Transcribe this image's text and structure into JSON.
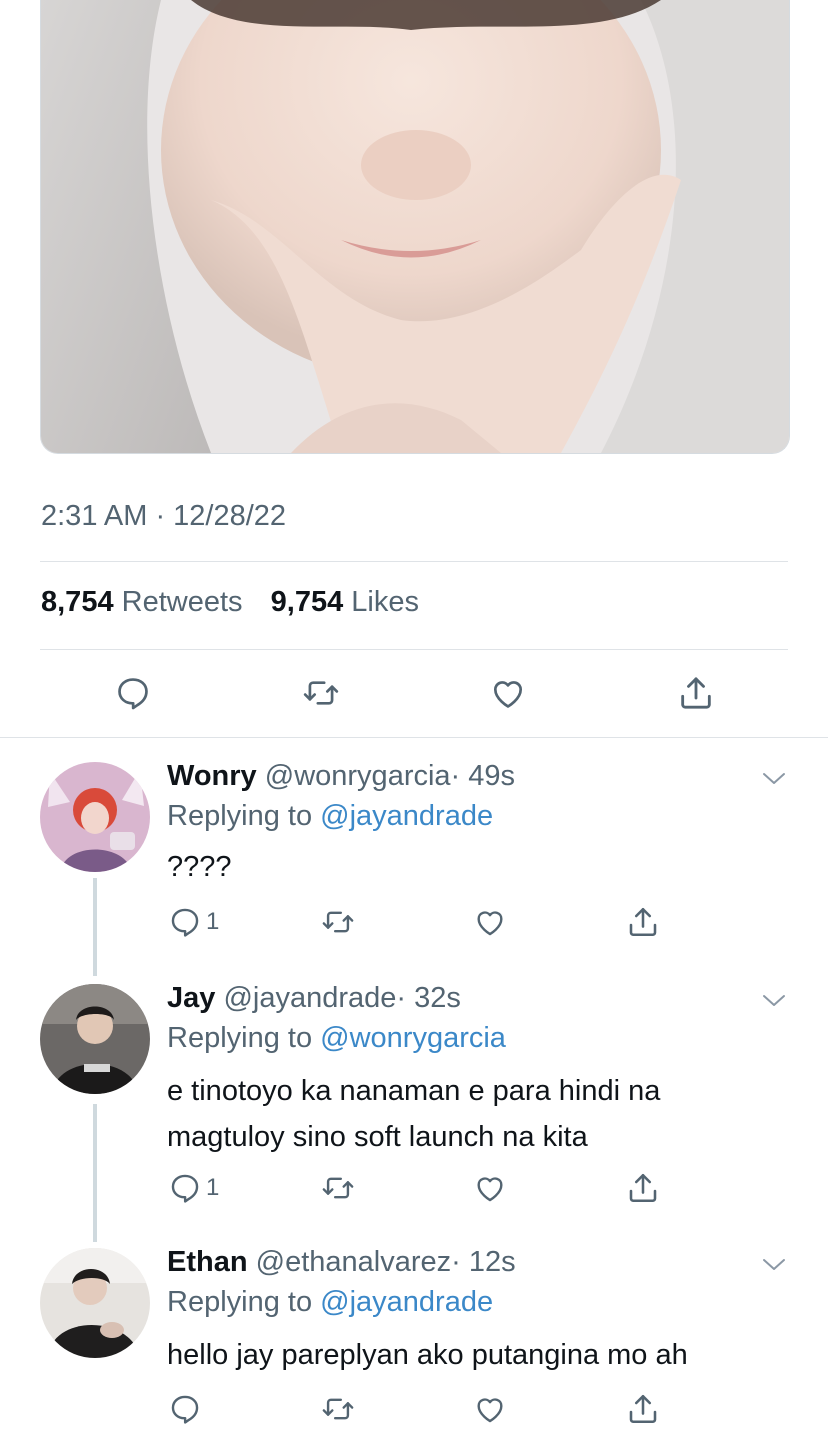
{
  "tweet": {
    "timestamp": "2:31 AM · 12/28/22",
    "retweets_count": "8,754",
    "retweets_label": "Retweets",
    "likes_count": "9,754",
    "likes_label": "Likes",
    "icons": [
      "reply-icon",
      "retweet-icon",
      "like-icon",
      "share-icon"
    ]
  },
  "replies": [
    {
      "name": "Wonry",
      "handle": "@wonrygarcia",
      "time": "· 49s",
      "replying_prefix": "Replying to",
      "replying_to": "@jayandrade",
      "text": "????",
      "reply_count": "1"
    },
    {
      "name": "Jay",
      "handle": "@jayandrade",
      "time": "· 32s",
      "replying_prefix": "Replying to",
      "replying_to": "@wonrygarcia",
      "text": "e tinotoyo ka nanaman e para hindi na magtuloy sino soft launch na kita",
      "reply_count": "1"
    },
    {
      "name": "Ethan",
      "handle": "@ethanalvarez",
      "time": "· 12s",
      "replying_prefix": "Replying to",
      "replying_to": "@jayandrade",
      "text": "hello jay pareplyan ako putangina mo ah",
      "reply_count": ""
    }
  ],
  "colors": {
    "text": "#0f1419",
    "secondary": "#536471",
    "link": "#3b88c8",
    "divider": "#dfe3e7",
    "thread_line": "#cfd9de"
  }
}
